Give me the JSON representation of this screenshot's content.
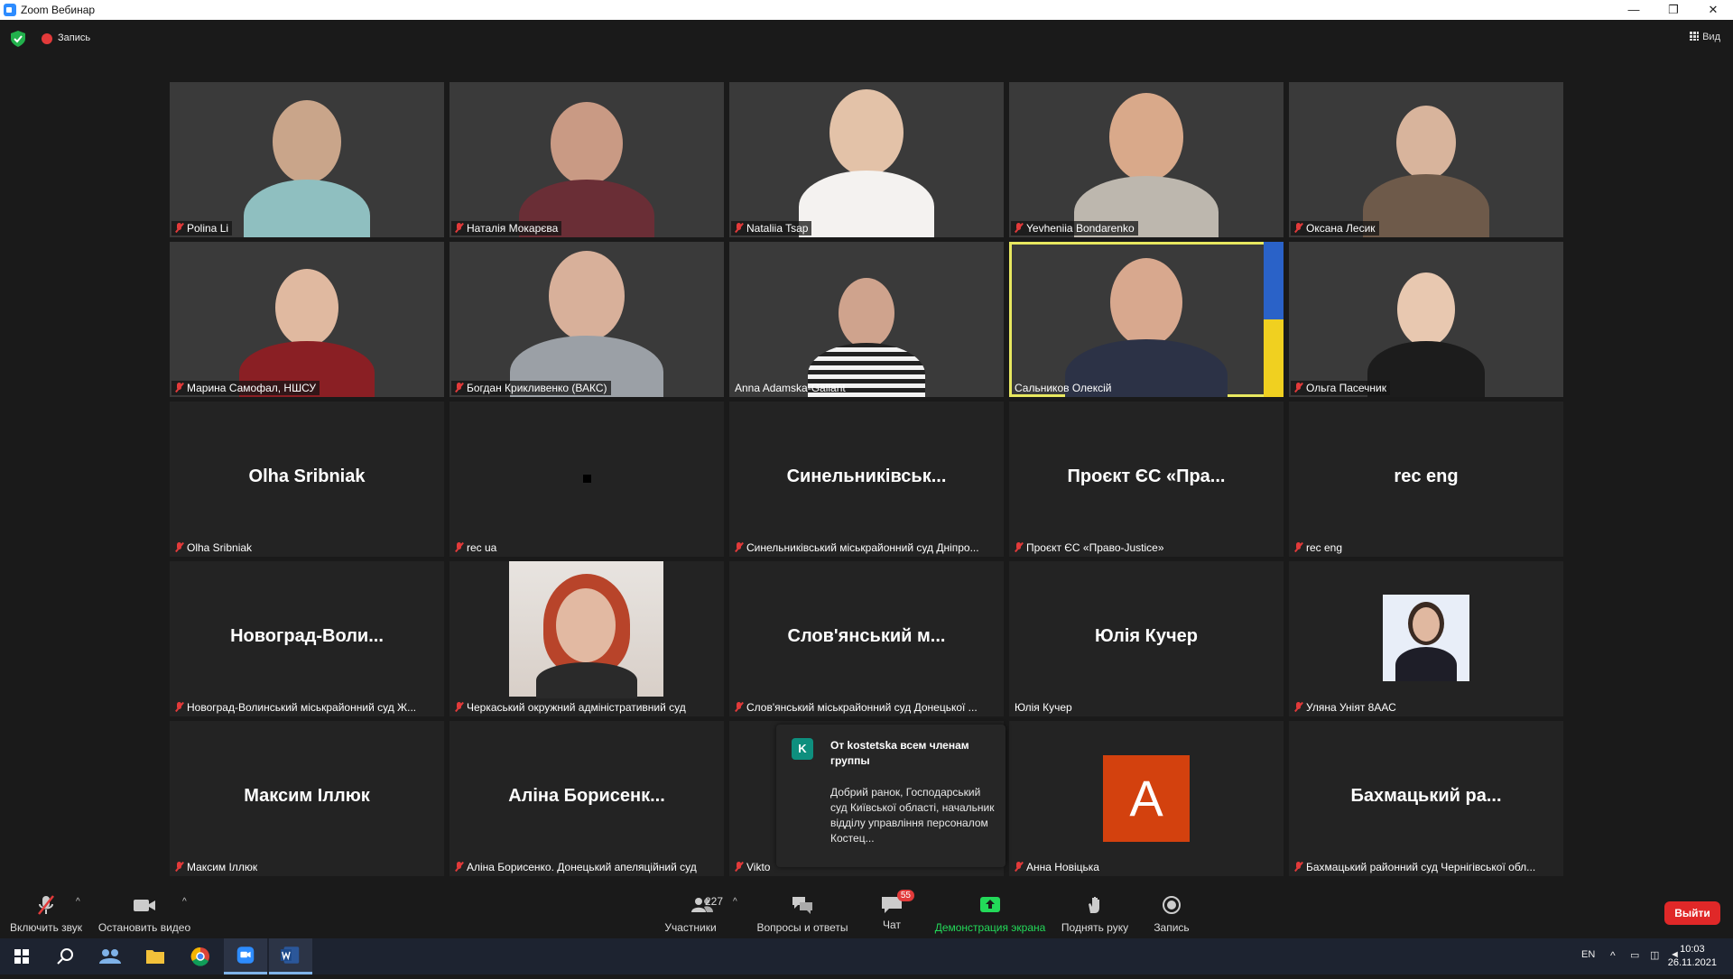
{
  "window": {
    "title": "Zoom Вебинар",
    "minimize": "—",
    "restore": "❐",
    "close": "✕"
  },
  "topbar": {
    "recording_label": "Запись",
    "view_label": "Вид"
  },
  "tiles": [
    {
      "label": "Polina Li",
      "muted": true,
      "type": "video"
    },
    {
      "label": "Наталія Мокарєва",
      "muted": true,
      "type": "video"
    },
    {
      "label": "Nataliia Tsap",
      "muted": true,
      "type": "video"
    },
    {
      "label": "Yevheniia Bondarenko",
      "muted": true,
      "type": "video"
    },
    {
      "label": "Оксана Лесик",
      "muted": true,
      "type": "video"
    },
    {
      "label": "Марина Самофал, НШСУ",
      "muted": true,
      "type": "video"
    },
    {
      "label": "Богдан Крикливенко (ВАКС)",
      "muted": true,
      "type": "video"
    },
    {
      "label": "Anna Adamska-Gallant",
      "muted": false,
      "type": "video"
    },
    {
      "label": "Сальников Олексій",
      "muted": false,
      "type": "video",
      "speaking": true
    },
    {
      "label": "Ольга Пасечник",
      "muted": true,
      "type": "video"
    },
    {
      "big": "Olha Sribniak",
      "label": "Olha Sribniak",
      "muted": true,
      "type": "name"
    },
    {
      "big": "",
      "label": "rec ua",
      "muted": true,
      "type": "dot"
    },
    {
      "big": "Синельниківськ...",
      "label": "Синельниківський міськрайонний суд Дніпро...",
      "muted": true,
      "type": "name"
    },
    {
      "big": "Проєкт ЄС «Пра...",
      "label": "Проєкт ЄС «Право-Justice»",
      "muted": true,
      "type": "name"
    },
    {
      "big": "rec eng",
      "label": "rec eng",
      "muted": true,
      "type": "name"
    },
    {
      "big": "Новоград-Воли...",
      "label": "Новоград-Волинський міськрайонний суд Ж...",
      "muted": true,
      "type": "name"
    },
    {
      "big": "",
      "label": "Черкаський окружний адміністративний суд",
      "muted": true,
      "type": "photo"
    },
    {
      "big": "Слов'янський м...",
      "label": "Слов'янський міськрайонний суд Донецької ...",
      "muted": true,
      "type": "name"
    },
    {
      "big": "Юлія Кучер",
      "label": "Юлія Кучер",
      "muted": false,
      "type": "name"
    },
    {
      "big": "",
      "label": "Уляна Уніят 8ААС",
      "muted": true,
      "type": "smallphoto"
    },
    {
      "big": "Максим Іллюк",
      "label": "Максим Іллюк",
      "muted": true,
      "type": "name"
    },
    {
      "big": "Аліна Борисенк...",
      "label": "Аліна Борисенко. Донецький апеляційний суд",
      "muted": true,
      "type": "name"
    },
    {
      "big": "",
      "label": "Vikto",
      "muted": true,
      "type": "blank"
    },
    {
      "big": "",
      "label": "Анна Новіцька",
      "muted": true,
      "type": "avatar",
      "avatar_letter": "А"
    },
    {
      "big": "Бахмацький ра...",
      "label": "Бахмацький районний суд Чернігівської обл...",
      "muted": true,
      "type": "name"
    }
  ],
  "chat_popup": {
    "avatar_letter": "K",
    "from": "От kostetska всем членам группы",
    "message": "Добрий ранок, Господарський суд Київської області, начальник відділу управління персоналом Костец..."
  },
  "toolbar": {
    "unmute": "Включить звук",
    "video": "Остановить видео",
    "participants": "Участники",
    "participants_count": "227",
    "qa": "Вопросы и ответы",
    "chat": "Чат",
    "chat_badge": "55",
    "share": "Демонстрация экрана",
    "raise_hand": "Поднять руку",
    "record": "Запись",
    "leave": "Выйти"
  },
  "taskbar": {
    "lang": "EN",
    "time": "10:03",
    "date": "26.11.2021"
  },
  "colors": {
    "share_green": "#23d959",
    "leave_red": "#e02828",
    "speaking_border": "#e8e860"
  }
}
